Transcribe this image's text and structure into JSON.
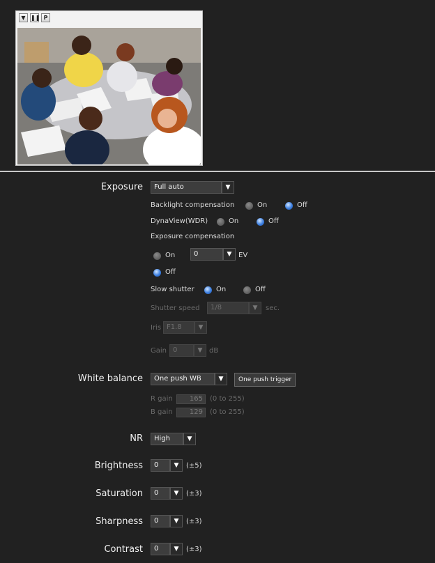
{
  "viewer": {
    "buttons": [
      "▼",
      "❚❚",
      "P"
    ]
  },
  "exposure": {
    "label": "Exposure",
    "mode": "Full auto",
    "backlight_label": "Backlight compensation",
    "dynaview_label": "DynaView(WDR)",
    "on": "On",
    "off": "Off",
    "comp_label": "Exposure compensation",
    "comp_value": "0",
    "comp_unit": "EV",
    "slow_shutter_label": "Slow shutter",
    "shutter_speed_label": "Shutter speed",
    "shutter_speed_value": "1/8",
    "shutter_unit": "sec.",
    "iris_label": "Iris",
    "iris_value": "F1.8",
    "gain_label": "Gain",
    "gain_value": "0",
    "gain_unit": "dB"
  },
  "white_balance": {
    "label": "White balance",
    "mode": "One push WB",
    "trigger_label": "One push trigger",
    "r_gain_label": "R gain",
    "r_gain_value": "165",
    "r_gain_range": "(0 to 255)",
    "b_gain_label": "B gain",
    "b_gain_value": "129",
    "b_gain_range": "(0 to 255)"
  },
  "nr": {
    "label": "NR",
    "value": "High"
  },
  "brightness": {
    "label": "Brightness",
    "value": "0",
    "range": "(±5)"
  },
  "saturation": {
    "label": "Saturation",
    "value": "0",
    "range": "(±3)"
  },
  "sharpness": {
    "label": "Sharpness",
    "value": "0",
    "range": "(±3)"
  },
  "contrast": {
    "label": "Contrast",
    "value": "0",
    "range": "(±3)"
  }
}
